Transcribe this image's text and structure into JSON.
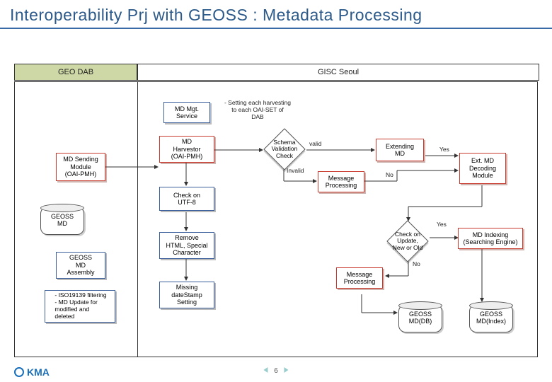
{
  "title": "Interoperability Prj with GEOSS : Metadata Processing",
  "columns": {
    "geodab": "GEO DAB",
    "gisc": "GISC Seoul"
  },
  "nodes": {
    "md_sending": "MD Sending\nModule\n(OAI-PMH)",
    "geoss_md": "GEOSS\nMD",
    "geoss_md_assembly": "GEOSS\nMD\nAssembly",
    "iso_note": "- ISO19139 filtering\n- MD Update for\nmodified and\ndeleted",
    "md_mgt": "MD Mgt.\nService",
    "md_mgt_note": "- Setting each harvesting\nto each OAI-SET of\nDAB",
    "md_harvestor": "MD\nHarvestor\n(OAI-PMH)",
    "check_utf8": "Check on\nUTF-8",
    "remove_html": "Remove\nHTML, Special\nCharacter",
    "missing_date": "Missing\ndateStamp\nSetting",
    "schema_check": "Schema\nValidation\nCheck",
    "msg_proc1": "Message\nProcessing",
    "extending_md": "Extending\nMD",
    "ext_decode": "Ext. MD\nDecoding\nModule",
    "update_check": "Check on\nUpdate,\nNew or Old",
    "msg_proc2": "Message\nProcessing",
    "geoss_md_db": "GEOSS\nMD(DB)",
    "md_indexing": "MD Indexing\n(Searching Engine)",
    "geoss_md_index": "GEOSS\nMD(Index)"
  },
  "labels": {
    "valid": "valid",
    "invalid": "Invalid",
    "yes": "Yes",
    "no": "No"
  },
  "page_number": "6",
  "footer_brand": "KMA"
}
